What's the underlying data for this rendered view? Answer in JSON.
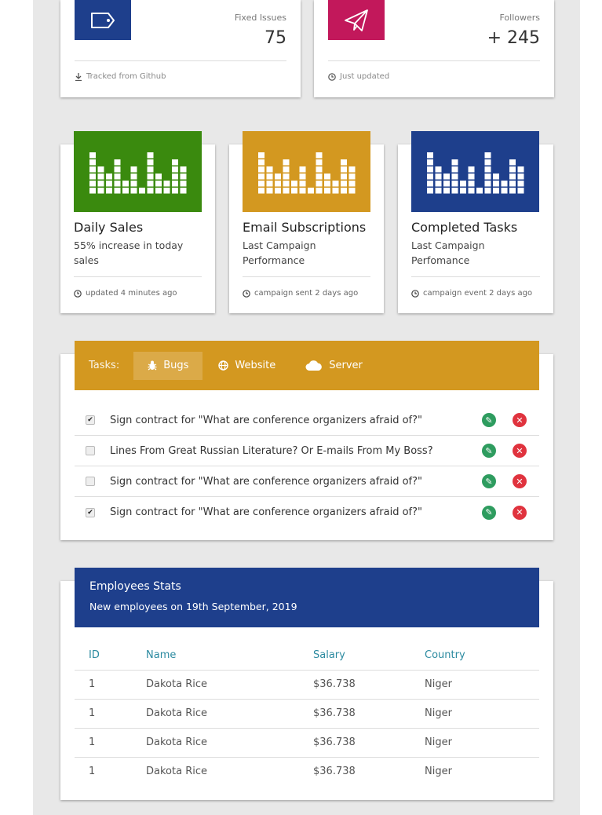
{
  "stats": [
    {
      "label": "Fixed Issues",
      "value": "75",
      "footer": "Tracked from Github",
      "color": "#1e3f8c",
      "icon": "tag-icon",
      "footer_icon": "download-icon"
    },
    {
      "label": "Followers",
      "value": "+ 245",
      "footer": "Just updated",
      "color": "#c2185b",
      "icon": "paper-plane-icon",
      "footer_icon": "clock-icon"
    }
  ],
  "charts": [
    {
      "title": "Daily Sales",
      "desc": "55% increase in today sales",
      "footer": "updated 4 minutes ago",
      "color": "#3a8a0e"
    },
    {
      "title": "Email Subscriptions",
      "desc": "Last Campaign Performance",
      "footer": "campaign sent 2 days ago",
      "color": "#d39820"
    },
    {
      "title": "Completed Tasks",
      "desc": "Last Campaign Perfomance",
      "footer": "campaign event 2 days ago",
      "color": "#1e3f8c"
    }
  ],
  "tasks": {
    "label": "Tasks:",
    "tabs": [
      {
        "label": "Bugs",
        "icon": "bug-icon",
        "active": true
      },
      {
        "label": "Website",
        "icon": "globe-icon",
        "active": false
      },
      {
        "label": "Server",
        "icon": "cloud-icon",
        "active": false
      }
    ],
    "items": [
      {
        "text": "Sign contract for \"What are conference organizers afraid of?\"",
        "checked": true
      },
      {
        "text": "Lines From Great Russian Literature? Or E-mails From My Boss?",
        "checked": false
      },
      {
        "text": "Sign contract for \"What are conference organizers afraid of?\"",
        "checked": false
      },
      {
        "text": "Sign contract for \"What are conference organizers afraid of?\"",
        "checked": true
      }
    ],
    "edit_color": "#2e9c5f",
    "delete_color": "#e0333e"
  },
  "employees": {
    "title": "Employees Stats",
    "subtitle": "New employees on 19th September, 2019",
    "columns": [
      "ID",
      "Name",
      "Salary",
      "Country"
    ],
    "rows": [
      [
        "1",
        "Dakota Rice",
        "$36.738",
        "Niger"
      ],
      [
        "1",
        "Dakota Rice",
        "$36.738",
        "Niger"
      ],
      [
        "1",
        "Dakota Rice",
        "$36.738",
        "Niger"
      ],
      [
        "1",
        "Dakota Rice",
        "$36.738",
        "Niger"
      ]
    ]
  }
}
